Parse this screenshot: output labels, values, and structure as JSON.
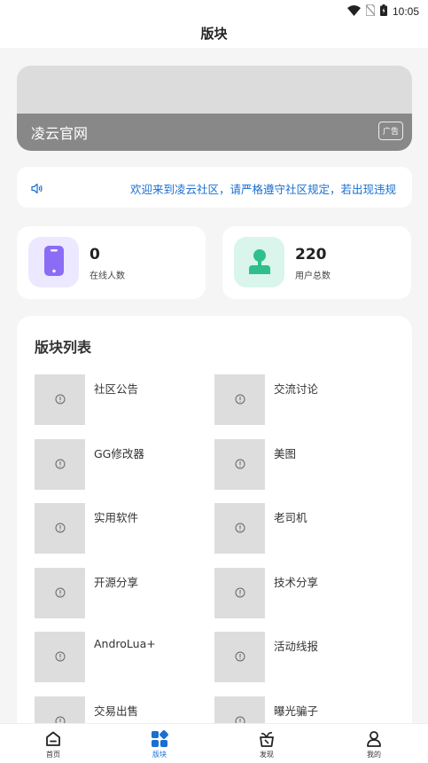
{
  "status_bar": {
    "time": "10:05"
  },
  "app_bar": {
    "title": "版块"
  },
  "banner": {
    "title": "凌云官网",
    "ad_label": "广告"
  },
  "notice": {
    "text": "欢迎来到凌云社区，请严格遵守社区规定，若出现违规"
  },
  "stats": [
    {
      "value": "0",
      "label": "在线人数",
      "icon": "phone-icon",
      "bg": "#ece8ff",
      "color": "#8b6cf5"
    },
    {
      "value": "220",
      "label": "用户总数",
      "icon": "user-icon",
      "bg": "#d9f5ec",
      "color": "#2fbf8c"
    }
  ],
  "board_list": {
    "title": "版块列表",
    "items": [
      {
        "name": "社区公告"
      },
      {
        "name": "交流讨论"
      },
      {
        "name": "GG修改器"
      },
      {
        "name": "美图"
      },
      {
        "name": "实用软件"
      },
      {
        "name": "老司机"
      },
      {
        "name": "开源分享"
      },
      {
        "name": "技术分享"
      },
      {
        "name": "AndroLua+"
      },
      {
        "name": "活动线报"
      },
      {
        "name": "交易出售"
      },
      {
        "name": "曝光骗子"
      }
    ]
  },
  "bottom_nav": [
    {
      "label": "首页",
      "icon": "home-icon",
      "active": false
    },
    {
      "label": "版块",
      "icon": "grid-icon",
      "active": true
    },
    {
      "label": "发现",
      "icon": "discover-icon",
      "active": false
    },
    {
      "label": "我的",
      "icon": "profile-icon",
      "active": false
    }
  ],
  "colors": {
    "accent": "#1a6fd1",
    "background": "#f5f5f5"
  }
}
